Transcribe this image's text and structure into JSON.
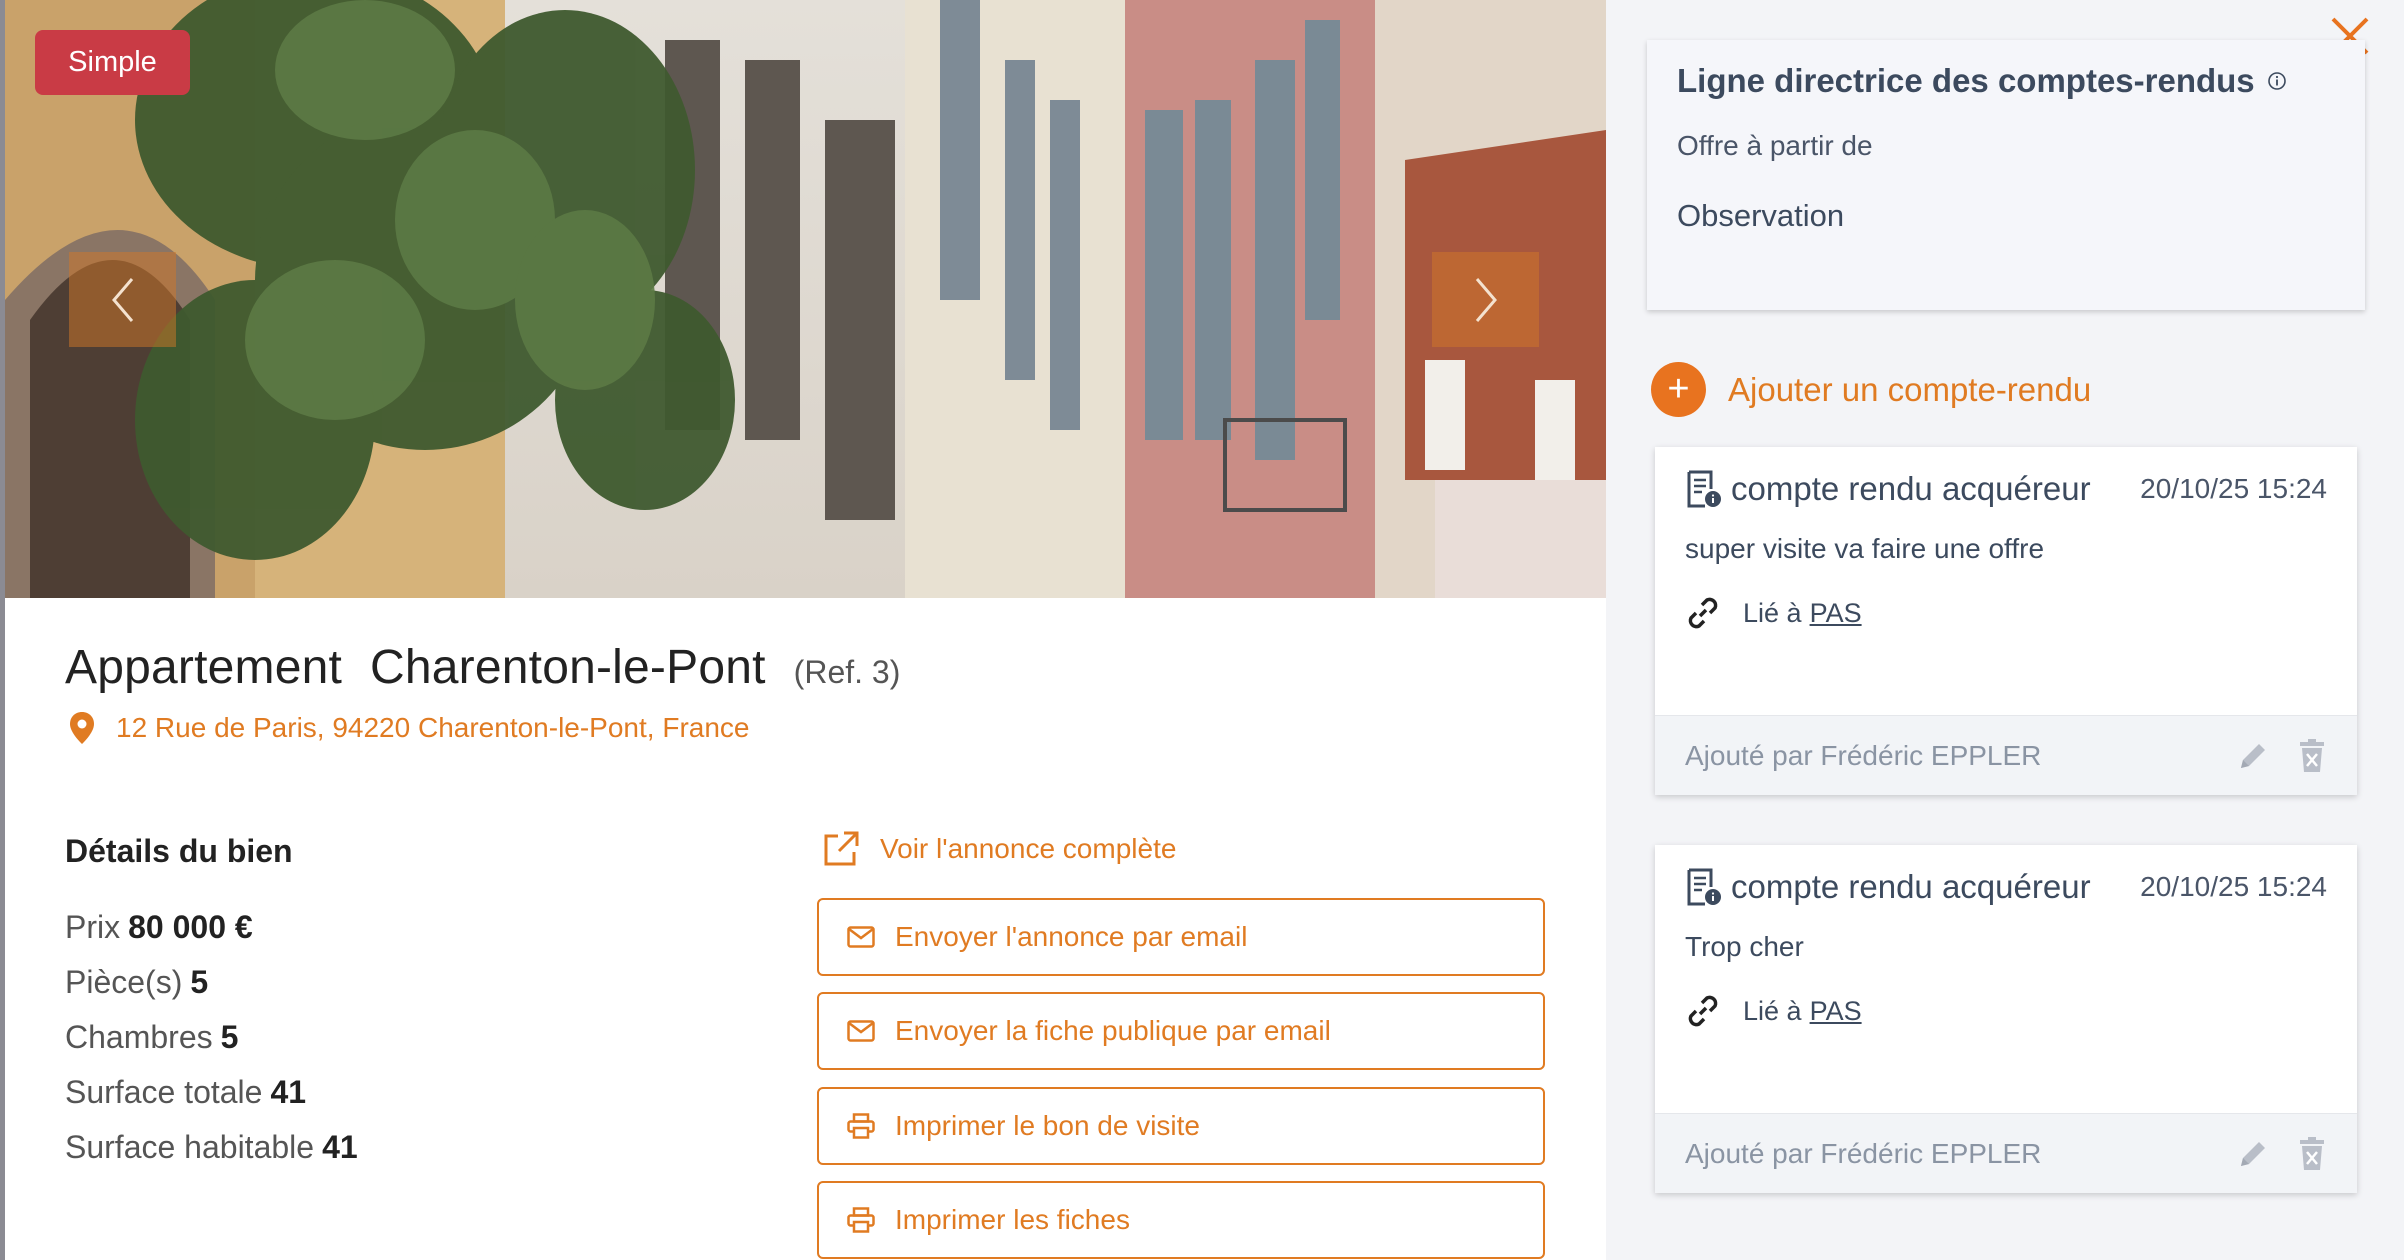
{
  "badge": "Simple",
  "listing": {
    "type": "Appartement",
    "city": "Charenton-le-Pont",
    "ref": "(Ref. 3)",
    "address": "12 Rue de Paris, 94220 Charenton-le-Pont, France"
  },
  "details": {
    "title": "Détails du bien",
    "rows": [
      {
        "label": "Prix",
        "value": "80 000 €"
      },
      {
        "label": "Pièce(s)",
        "value": "5"
      },
      {
        "label": "Chambres",
        "value": "5"
      },
      {
        "label": "Surface totale",
        "value": "41"
      },
      {
        "label": "Surface habitable",
        "value": "41"
      }
    ]
  },
  "actions": {
    "full_listing": "Voir l'annonce complète",
    "send_listing_email": "Envoyer l'annonce par email",
    "send_public_sheet_email": "Envoyer la fiche publique par email",
    "print_visit_voucher": "Imprimer le bon de visite",
    "print_sheets": "Imprimer les fiches"
  },
  "guide": {
    "title": "Ligne directrice des comptes-rendus",
    "offer_label": "Offre à partir de",
    "observation_label": "Observation"
  },
  "add_report": "Ajouter un compte-rendu",
  "reports": [
    {
      "kind": "compte rendu acquéreur",
      "date": "20/10/25 15:24",
      "text": "super visite va faire une offre",
      "linked_prefix": "Lié à",
      "linked_to": "PAS",
      "added_by": "Ajouté par Frédéric EPPLER"
    },
    {
      "kind": "compte rendu acquéreur",
      "date": "20/10/25 15:24",
      "text": "Trop cher",
      "linked_prefix": "Lié à",
      "linked_to": "PAS",
      "added_by": "Ajouté par Frédéric EPPLER"
    }
  ],
  "colors": {
    "accent": "#e07b22",
    "badge": "#c93b45",
    "panel": "#f3f4f7",
    "text_slate": "#3c4a5e"
  },
  "icons": {
    "close": "close-icon",
    "prev": "chevron-left-icon",
    "next": "chevron-right-icon",
    "pin": "map-pin-icon",
    "external": "external-link-icon",
    "mail": "mail-icon",
    "print": "printer-icon",
    "info": "info-icon",
    "plus": "plus-icon",
    "report": "report-icon",
    "link": "link-icon",
    "edit": "pencil-icon",
    "delete": "trash-icon"
  }
}
